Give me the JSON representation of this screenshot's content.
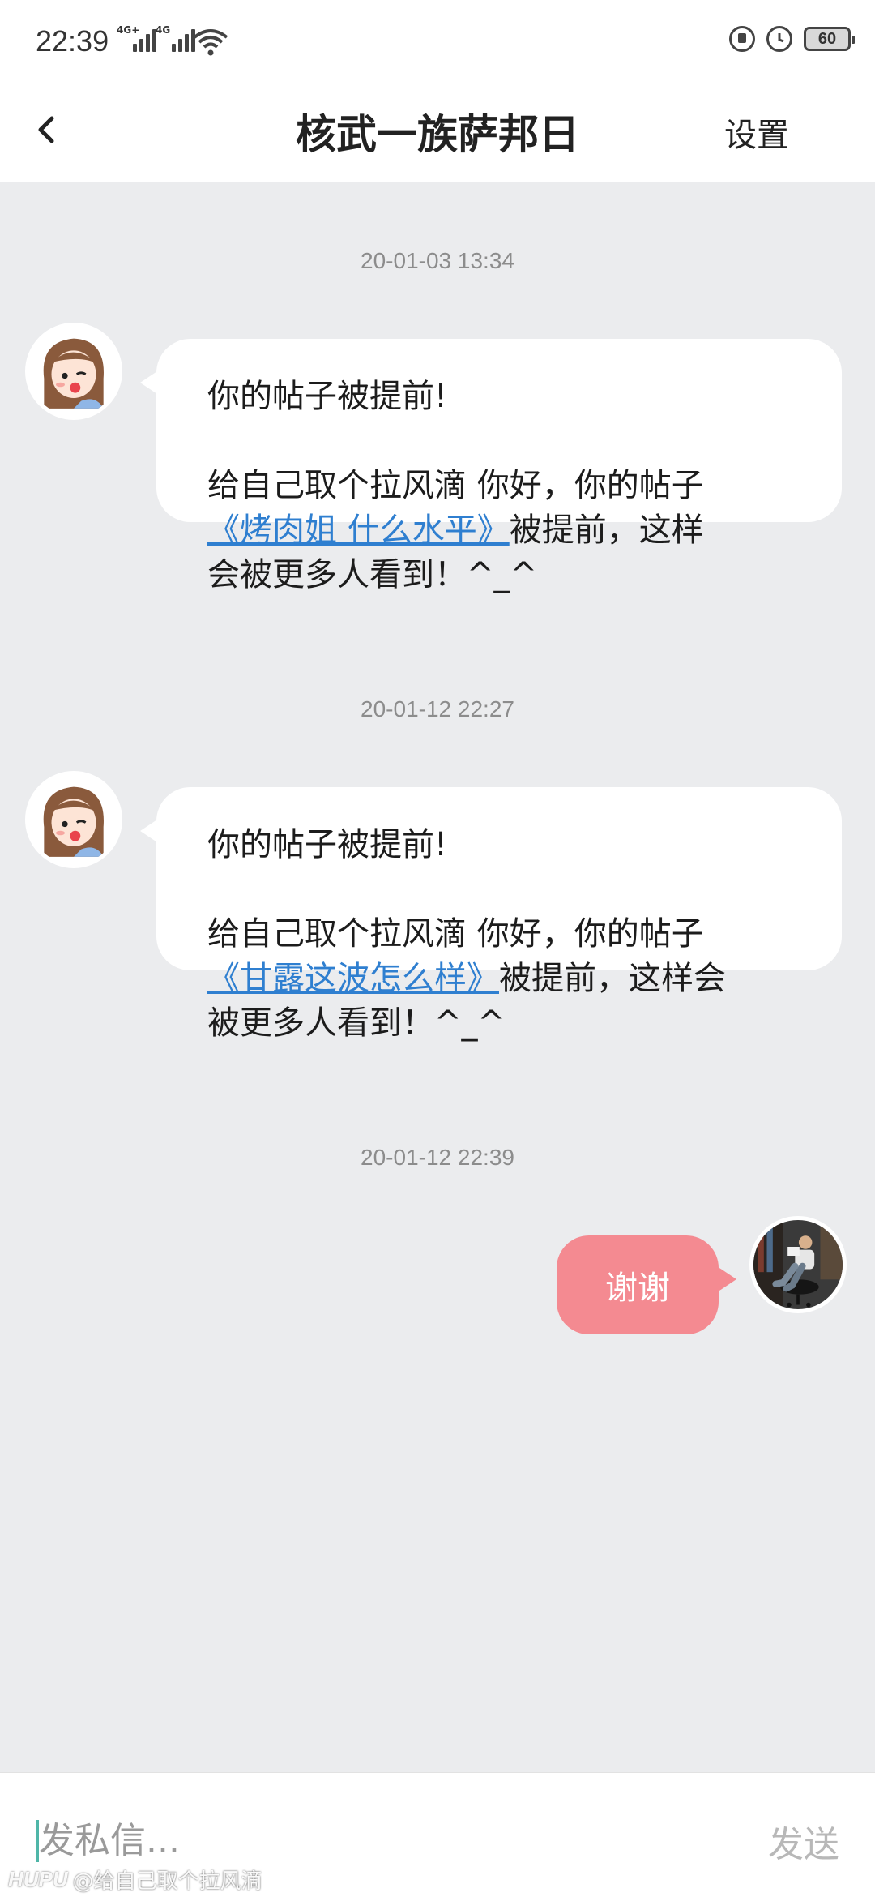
{
  "status_bar": {
    "time": "22:39",
    "signal_1_tag": "4G+",
    "signal_2_tag": "4G",
    "battery": "60",
    "icons": [
      "signal-icon",
      "wifi-icon",
      "lock-rotation-icon",
      "alarm-icon",
      "battery-icon"
    ]
  },
  "header": {
    "title": "核武一族萨邦日",
    "settings_label": "设置",
    "back_icon": "chevron-left-icon"
  },
  "messages": [
    {
      "timestamp": "20-01-03 13:34",
      "sender": "other",
      "line1": "你的帖子被提前!",
      "line2": "给自己取个拉风滴 你好，你的帖子",
      "link": "《烤肉姐 什么水平》",
      "after_link": "被提前，这样",
      "line4": "会被更多人看到！^_^"
    },
    {
      "timestamp": "20-01-12 22:27",
      "sender": "other",
      "line1": "你的帖子被提前!",
      "line2": "给自己取个拉风滴 你好，你的帖子",
      "link": "《甘露这波怎么样》",
      "after_link": "被提前，这样会",
      "line4": "被更多人看到！^_^"
    },
    {
      "timestamp": "20-01-12 22:39",
      "sender": "me",
      "text": "谢谢"
    }
  ],
  "input": {
    "placeholder": "发私信...",
    "value": "",
    "send_label": "发送"
  },
  "watermark": {
    "logo": "HUPU",
    "text": "@给自己取个拉风滴"
  },
  "colors": {
    "background": "#ebecee",
    "bubble": "#ffffff",
    "my_bubble": "#f48a91",
    "link": "#2f7fd0",
    "timestamp": "#8c8c8c"
  }
}
